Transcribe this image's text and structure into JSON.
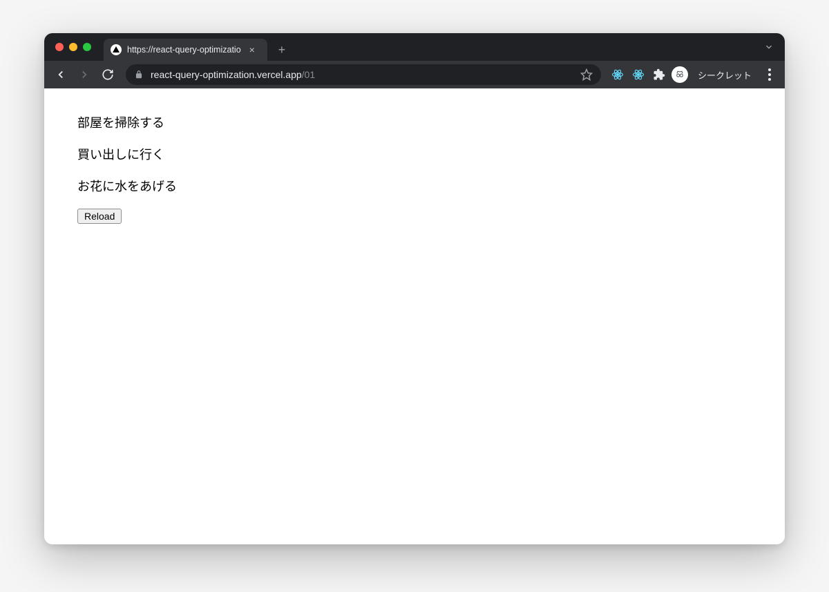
{
  "tab": {
    "title": "https://react-query-optimizatio",
    "close_label": "×"
  },
  "toolbar": {
    "new_tab_label": "+",
    "url_main": "react-query-optimization.vercel.app",
    "url_path": "/01",
    "incognito_label": "シークレット"
  },
  "content": {
    "items": [
      "部屋を掃除する",
      "買い出しに行く",
      "お花に水をあげる"
    ],
    "reload_label": "Reload"
  }
}
